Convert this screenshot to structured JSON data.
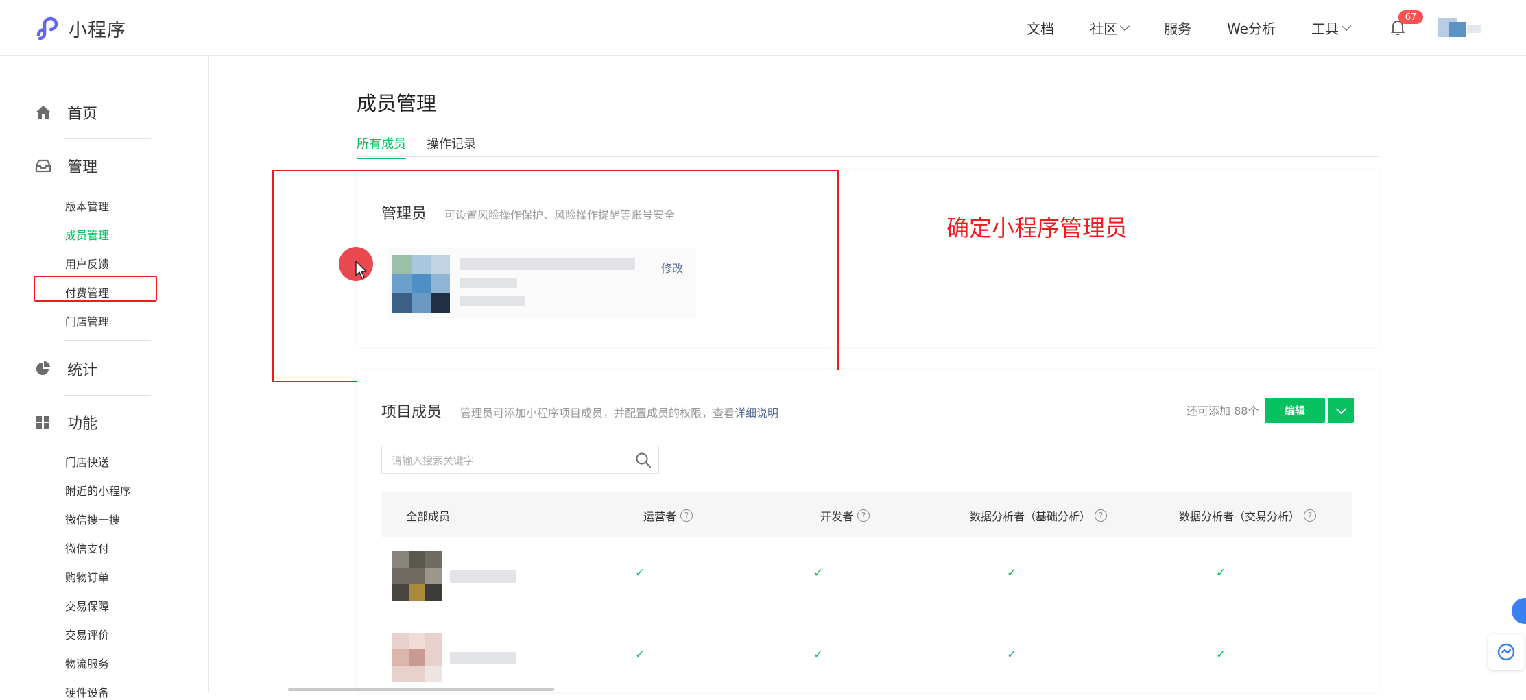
{
  "app": {
    "brand_name": "小程序"
  },
  "topnav": {
    "items": [
      {
        "label": "文档",
        "has_dropdown": false
      },
      {
        "label": "社区",
        "has_dropdown": true
      },
      {
        "label": "服务",
        "has_dropdown": false
      },
      {
        "label": "We分析",
        "has_dropdown": false
      },
      {
        "label": "工具",
        "has_dropdown": true
      }
    ],
    "notification_count": "67"
  },
  "sidebar": {
    "home": "首页",
    "manage": "管理",
    "manage_items": [
      "版本管理",
      "成员管理",
      "用户反馈",
      "付费管理",
      "门店管理"
    ],
    "active_item": "成员管理",
    "stats": "统计",
    "features": "功能",
    "feature_items": [
      "门店快送",
      "附近的小程序",
      "微信搜一搜",
      "微信支付",
      "购物订单",
      "交易保障",
      "交易评价",
      "物流服务",
      "硬件设备"
    ]
  },
  "page": {
    "title": "成员管理",
    "tabs": [
      {
        "label": "所有成员",
        "active": true
      },
      {
        "label": "操作记录",
        "active": false
      }
    ]
  },
  "admin": {
    "title": "管理员",
    "desc": "可设置风险操作保护、风险操作提醒等账号安全",
    "modify_label": "修改"
  },
  "annotation": {
    "text": "确定小程序管理员",
    "color": "#ee1d1d"
  },
  "members": {
    "title": "项目成员",
    "desc_prefix": "管理员可添加小程序项目成员，并配置成员的权限，查看",
    "desc_link": "详细说明",
    "remaining": "还可添加 88个",
    "edit_label": "编辑",
    "search_placeholder": "请输入搜索关键字",
    "columns": [
      "全部成员",
      "运营者",
      "开发者",
      "数据分析者（基础分析）",
      "数据分析者（交易分析）"
    ],
    "rows": [
      {
        "operator": true,
        "developer": true,
        "analyst_basic": true,
        "analyst_trade": true
      },
      {
        "operator": true,
        "developer": true,
        "analyst_basic": true,
        "analyst_trade": true
      }
    ]
  },
  "colors": {
    "accent": "#07c160",
    "link": "#576b95",
    "badge": "#fa5151"
  }
}
